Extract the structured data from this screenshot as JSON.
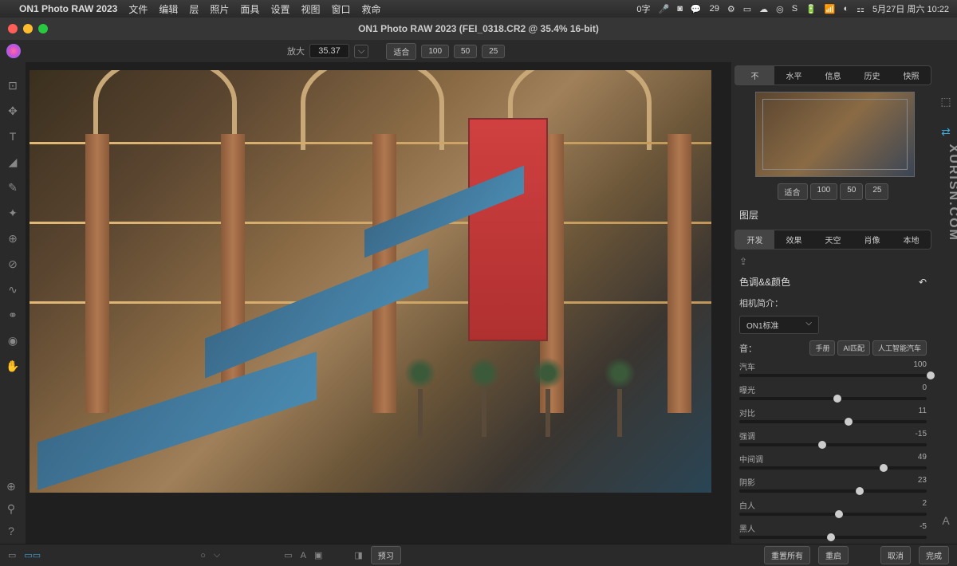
{
  "menubar": {
    "app": "ON1 Photo RAW 2023",
    "items": [
      "文件",
      "编辑",
      "层",
      "照片",
      "面具",
      "设置",
      "视图",
      "窗口",
      "救命"
    ],
    "right": {
      "input": "0字",
      "badge": "29",
      "date": "5月27日 周六 10:22"
    }
  },
  "titlebar": {
    "title": "ON1 Photo RAW 2023 (FEI_0318.CR2 @ 35.4% 16-bit)"
  },
  "zoom": {
    "label": "放大",
    "value": "35.37",
    "fit": "适合",
    "b1": "100",
    "b2": "50",
    "b3": "25"
  },
  "nav": {
    "tabs": [
      "不",
      "水平",
      "信息",
      "历史",
      "快照"
    ],
    "fit": "适合",
    "z1": "100",
    "z2": "50",
    "z3": "25"
  },
  "layers": {
    "title": "图层",
    "tabs": [
      "开发",
      "效果",
      "天空",
      "肖像",
      "本地"
    ]
  },
  "tone": {
    "title": "色调&&颜色",
    "profile_label": "相机简介：",
    "profile": "ON1标准",
    "tone_label": "音：",
    "buttons": [
      "手册",
      "AI匹配",
      "人工智能汽车"
    ],
    "sliders": [
      {
        "name": "汽车",
        "value": "100",
        "pos": "100"
      },
      {
        "name": "曝光",
        "value": "0",
        "pos": "50"
      },
      {
        "name": "对比",
        "value": "11",
        "pos": "56"
      },
      {
        "name": "强调",
        "value": "-15",
        "pos": "42"
      },
      {
        "name": "中间调",
        "value": "49",
        "pos": "75"
      },
      {
        "name": "阴影",
        "value": "23",
        "pos": "62"
      },
      {
        "name": "白人",
        "value": "2",
        "pos": "51"
      },
      {
        "name": "黑人",
        "value": "-5",
        "pos": "47"
      }
    ]
  },
  "bottom": {
    "preview": "预习",
    "reset_all": "重置所有",
    "reset": "重启",
    "cancel": "取消",
    "done": "完成"
  },
  "watermark": "XURISN.COM"
}
